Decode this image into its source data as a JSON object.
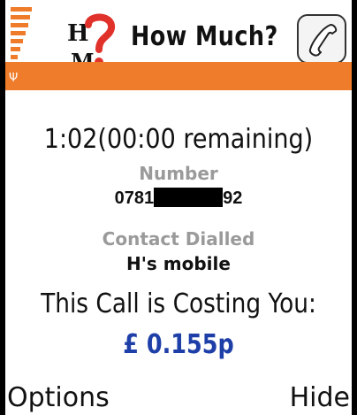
{
  "header": {
    "logo_icon": "hm-question-logo-icon",
    "title": "How Much?",
    "call_button_icon": "phone-handset-icon",
    "accent_color": "#ef7c2b"
  },
  "status": {
    "signal_icon": "signal-strength-icon",
    "antenna_icon": "antenna-icon"
  },
  "call": {
    "elapsed": "1:02(00:00 remaining)",
    "number_label": "Number",
    "number_prefix": "0781",
    "number_suffix": "92",
    "contact_label": "Contact Dialled",
    "contact_name": "H's mobile",
    "costing_label": "This Call is Costing You:",
    "cost": "£ 0.155p",
    "cost_color": "#1e3fa8"
  },
  "softkeys": {
    "left": "Options",
    "right": "Hide"
  }
}
